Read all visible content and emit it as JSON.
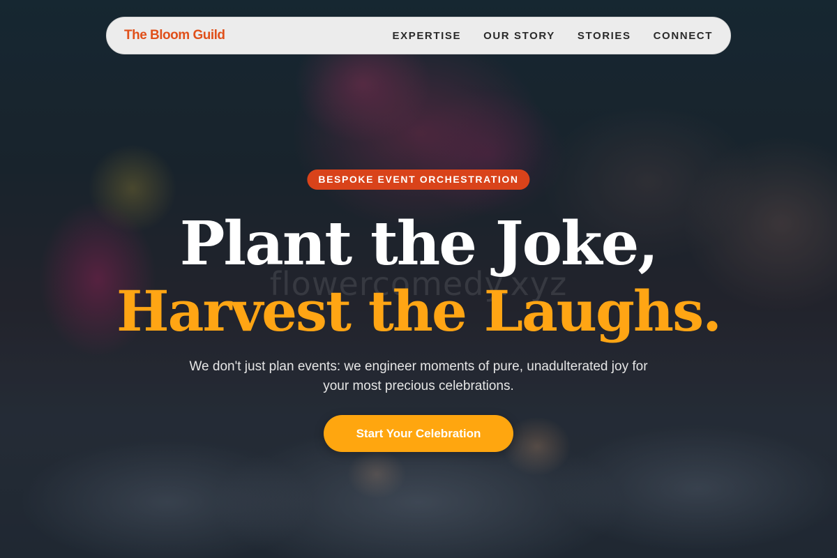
{
  "navbar": {
    "brand": "The Bloom Guild",
    "links": [
      "EXPERTISE",
      "OUR STORY",
      "STORIES",
      "CONNECT"
    ]
  },
  "hero": {
    "badge": "BESPOKE EVENT ORCHESTRATION",
    "headline_line1": "Plant the Joke,",
    "headline_line2": "Harvest the Laughs.",
    "subtext": "We don't just plan events: we engineer moments of pure, unadulterated joy for your most precious celebrations.",
    "cta_label": "Start Your Celebration",
    "watermark": "flowercomedy.xyz"
  },
  "colors": {
    "brand": "#e0501a",
    "badge": "#d9431a",
    "accent": "#ffa514",
    "navbar_bg": "#ececec"
  }
}
